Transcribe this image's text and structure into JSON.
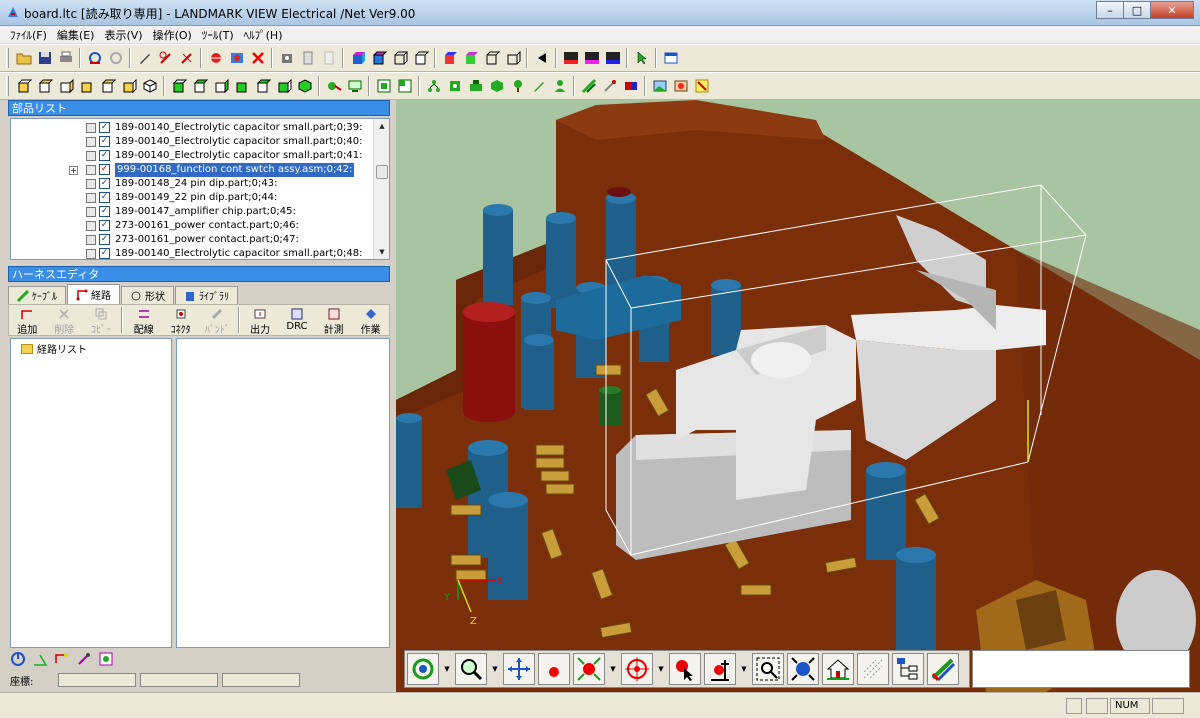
{
  "window": {
    "title": "board.ltc [読み取り専用] - LANDMARK VIEW Electrical /Net Ver9.00",
    "min_label": "–",
    "max_label": "□",
    "close_label": "✕"
  },
  "menu": {
    "items": [
      "ﾌｧｲﾙ(F)",
      "編集(E)",
      "表示(V)",
      "操作(O)",
      "ﾂｰﾙ(T)",
      "ﾍﾙﾌﾟ(H)"
    ]
  },
  "parts_panel": {
    "header": "部品リスト",
    "rows": [
      {
        "label": "189-00140_Electrolytic capacitor small.part;0;39:",
        "selected": false
      },
      {
        "label": "189-00140_Electrolytic capacitor small.part;0;40:",
        "selected": false
      },
      {
        "label": "189-00140_Electrolytic capacitor small.part;0;41:",
        "selected": false
      },
      {
        "label": "999-00168_function cont swtch assy.asm;0;42:",
        "selected": true
      },
      {
        "label": "189-00148_24 pin dip.part;0;43:",
        "selected": false
      },
      {
        "label": "189-00149_22 pin dip.part;0;44:",
        "selected": false
      },
      {
        "label": "189-00147_amplifier chip.part;0;45:",
        "selected": false
      },
      {
        "label": "273-00161_power contact.part;0;46:",
        "selected": false
      },
      {
        "label": "273-00161_power contact.part;0;47:",
        "selected": false
      },
      {
        "label": "189-00140_Electrolytic capacitor small.part;0;48:",
        "selected": false
      }
    ]
  },
  "harness_panel": {
    "header": "ハーネスエディタ",
    "tabs": [
      {
        "label": "ｹｰﾌﾞﾙ",
        "active": false
      },
      {
        "label": "経路",
        "active": true
      },
      {
        "label": "形状",
        "active": false
      },
      {
        "label": "ﾗｲﾌﾞﾗﾘ",
        "active": false
      }
    ],
    "buttons": [
      {
        "label": "追加",
        "enabled": true
      },
      {
        "label": "削除",
        "enabled": false
      },
      {
        "label": "ｺﾋﾟｰ",
        "enabled": false
      },
      {
        "label": "配線",
        "enabled": true
      },
      {
        "label": "ｺﾈｸﾀ",
        "enabled": true
      },
      {
        "label": "ﾊﾞﾝﾄﾞ",
        "enabled": false
      },
      {
        "label": "出力",
        "enabled": true
      },
      {
        "label": "DRC",
        "enabled": true
      },
      {
        "label": "計測",
        "enabled": true
      },
      {
        "label": "作業",
        "enabled": true
      }
    ],
    "route_list_label": "経路リスト"
  },
  "coords": {
    "label": "座標:"
  },
  "viewport": {
    "axis_labels": {
      "x": "X",
      "y": "Y",
      "z": "Z"
    }
  },
  "statusbar": {
    "num_label": "NUM"
  },
  "colors": {
    "board": "#7a2e0a",
    "capacitor": "#1f5f8a",
    "selection_header": "#3a8ee6",
    "viewport_bg": "#a9c4a0"
  }
}
